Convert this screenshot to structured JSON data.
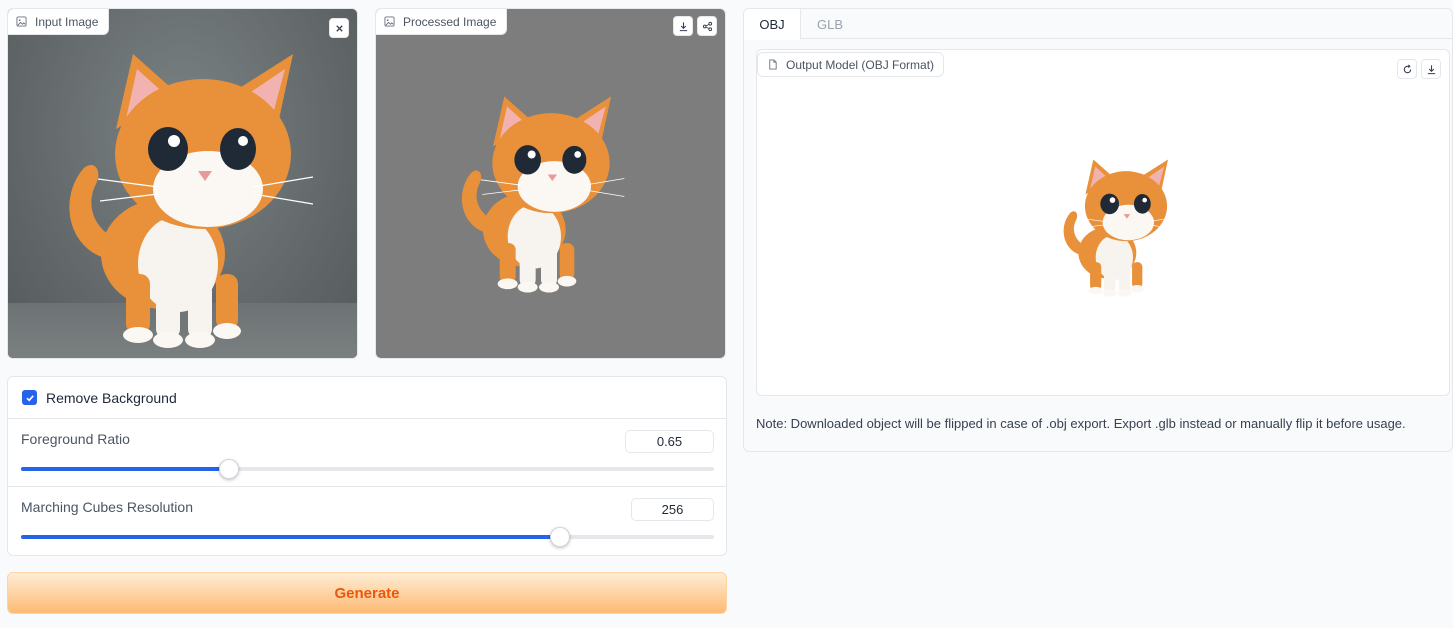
{
  "input_panel": {
    "label": "Input Image",
    "clear_icon": "close-icon"
  },
  "processed_panel": {
    "label": "Processed Image",
    "download_icon": "download-icon",
    "share_icon": "share-icon"
  },
  "controls": {
    "remove_background": {
      "label": "Remove Background",
      "checked": true
    },
    "foreground_ratio": {
      "label": "Foreground Ratio",
      "value": "0.65",
      "min": 0.5,
      "max": 1.0
    },
    "marching_cubes": {
      "label": "Marching Cubes Resolution",
      "value": "256",
      "min": 32,
      "max": 320
    }
  },
  "generate_button": {
    "label": "Generate"
  },
  "output": {
    "tabs": [
      {
        "label": "OBJ",
        "active": true
      },
      {
        "label": "GLB",
        "active": false
      }
    ],
    "model_label": "Output Model (OBJ Format)",
    "reset_icon": "reset-view-icon",
    "download_icon": "download-icon",
    "note": "Note: Downloaded object will be flipped in case of .obj export. Export .glb instead or manually flip it before usage."
  },
  "colors": {
    "accent": "#2563eb",
    "generate_text": "#ea580c",
    "cat_orange": "#e8913a"
  }
}
